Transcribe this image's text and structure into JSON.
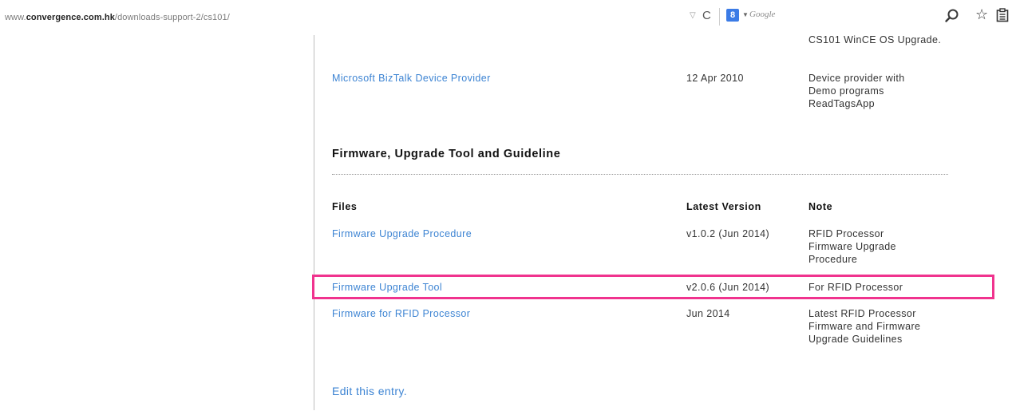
{
  "browser": {
    "url_domain_prefix": "www.",
    "url_domain": "convergence.com.hk",
    "url_path": "/downloads-support-2/cs101/",
    "search_placeholder": "Google",
    "search_engine_badge": "8"
  },
  "top_row": {
    "note": "CS101 WinCE OS Upgrade."
  },
  "biztalk_row": {
    "file": "Microsoft BizTalk Device Provider",
    "version": "12 Apr 2010",
    "note_lines": [
      "Device provider with",
      "Demo programs",
      "ReadTagsApp"
    ]
  },
  "section": {
    "title": "Firmware, Upgrade Tool and Guideline"
  },
  "table": {
    "headers": {
      "files": "Files",
      "version": "Latest Version",
      "note": "Note"
    },
    "rows": [
      {
        "file": "Firmware Upgrade Procedure",
        "version": "v1.0.2 (Jun 2014)",
        "note_lines": [
          "RFID Processor",
          "Firmware Upgrade",
          "Procedure"
        ]
      },
      {
        "file": "Firmware Upgrade Tool",
        "version": "v2.0.6 (Jun 2014)",
        "note_lines": [
          "For RFID Processor"
        ]
      },
      {
        "file": "Firmware for RFID Processor",
        "version": "Jun 2014",
        "note_lines": [
          "Latest RFID Processor",
          "Firmware and Firmware",
          "Upgrade Guidelines"
        ]
      }
    ]
  },
  "edit_link": "Edit this entry.",
  "colors": {
    "link": "#3d84d3",
    "highlight": "#f0338e"
  },
  "icons": [
    "dropmarker-icon",
    "reload-icon",
    "google-search-icon",
    "magnifier-icon",
    "bookmark-star-icon",
    "clipboard-icon"
  ]
}
